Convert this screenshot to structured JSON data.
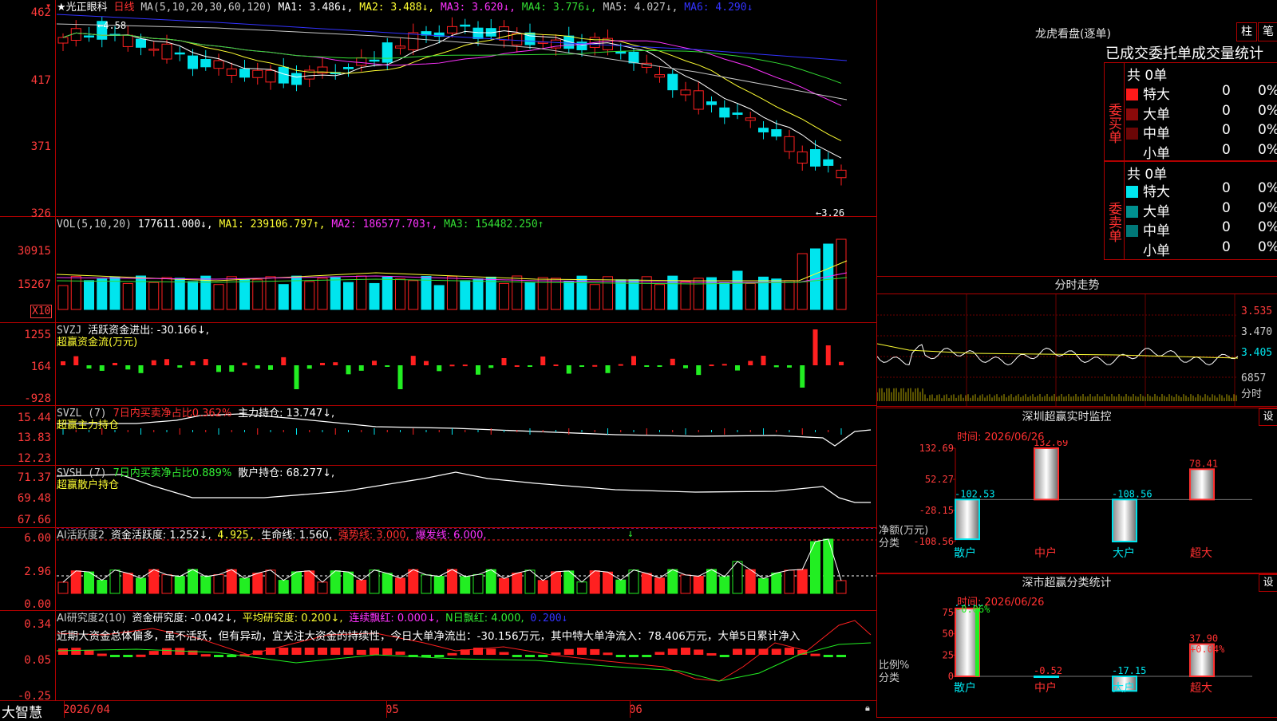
{
  "brand": "大智慧",
  "colors": {
    "up": "#ff2020",
    "down": "#00e5ee",
    "grid": "#b00000",
    "ma1": "#ffffff",
    "ma2": "#ffff33",
    "ma3": "#ff33ff",
    "ma4": "#33dd33",
    "ma5": "#c8c8c8",
    "ma6": "#3333ff",
    "green": "#22ee22"
  },
  "kline": {
    "star": "★",
    "stock": "光正眼科",
    "period": "日线",
    "ma_label": "MA(5,10,20,30,60,120)",
    "ma1": "MA1: 3.486↓,",
    "ma2": "MA2: 3.488↓,",
    "ma3": "MA3: 3.620↓,",
    "ma4": "MA4: 3.776↓,",
    "ma5": "MA5: 4.027↓,",
    "ma6": "MA6: 4.290↓",
    "yticks": [
      "462",
      "417",
      "371",
      "326"
    ],
    "high_note": "4.58",
    "low_note": "←3.26"
  },
  "vol": {
    "label": "VOL(5,10,20)",
    "v": "177611.000↓,",
    "ma1": "MA1: 239106.797↑,",
    "ma2": "MA2: 186577.703↑,",
    "ma3": "MA3: 154482.250↑",
    "yticks": [
      "30915",
      "15267"
    ],
    "unit": "X10"
  },
  "svzj": {
    "label": "SVZJ",
    "t1": "活跃资金进出: -30.166↓,",
    "t2": "超赢资金流(万元)",
    "yticks": [
      "1255",
      "164",
      "-928"
    ]
  },
  "svzl": {
    "label": "SVZL (7)",
    "t1": "7日内买卖净占比0.362%",
    "t2": "主力持仓: 13.747↓,",
    "t3": "超赢主力持仓",
    "yticks": [
      "15.44",
      "13.83",
      "12.23"
    ]
  },
  "svsh": {
    "label": "SVSH (7)",
    "t1": "7日内买卖净占比0.889%",
    "t2": "散户持仓: 68.277↓,",
    "t3": "超赢散户持仓",
    "yticks": [
      "71.37",
      "69.48",
      "67.66"
    ]
  },
  "ai1": {
    "label": "AI活跃度2",
    "t1": "资金活跃度: 1.252↓,",
    "t2": "4.925,",
    "t3": "生命线: 1.560,",
    "t4": "强势线: 3.000,",
    "t5": "爆发线: 6.000,",
    "yticks": [
      "6.00",
      "2.96",
      "0.00"
    ]
  },
  "ai2": {
    "label": "AI研究度2(10)",
    "t1": "资金研究度: -0.042↓,",
    "t2": "平均研究度: 0.200↓,",
    "t3": "连续飘红: 0.000↓,",
    "t4": "N日飘红: 4.000,",
    "t5": "0.200↓",
    "comment": "近期大资金总体偏多，虽不活跃，但有异动，宜关注大资金的持续性，今日大单净流出：-30.156万元，其中特大单净流入：78.406万元，大单5日累计净入",
    "yticks": [
      "0.34",
      "0.05",
      "-0.25"
    ]
  },
  "xaxis": [
    "2026/04",
    "05",
    "06"
  ],
  "dragon": {
    "title": "龙虎看盘(逐单)",
    "btn_bar": "柱",
    "btn_pen": "笔",
    "subtitle": "已成交委托单成交量统计",
    "buy": {
      "side": "委买单",
      "total": "共 0单",
      "rows": [
        {
          "name": "特大",
          "n": "0",
          "p": "0%"
        },
        {
          "name": "大单",
          "n": "0",
          "p": "0%"
        },
        {
          "name": "中单",
          "n": "0",
          "p": "0%"
        },
        {
          "name": "小单",
          "n": "0",
          "p": "0%"
        }
      ]
    },
    "sell": {
      "side": "委卖单",
      "total": "共 0单",
      "rows": [
        {
          "name": "特大",
          "n": "0",
          "p": "0%"
        },
        {
          "name": "大单",
          "n": "0",
          "p": "0%"
        },
        {
          "name": "中单",
          "n": "0",
          "p": "0%"
        },
        {
          "name": "小单",
          "n": "0",
          "p": "0%"
        }
      ]
    }
  },
  "intraday": {
    "title": "分时走势",
    "p1": "3.535",
    "p2": "3.470",
    "p3": "3.405",
    "vol": "6857",
    "vlabel": "分时"
  },
  "monitor": {
    "title": "深圳超赢实时监控",
    "btn": "设",
    "time": "时间: 2026/06/26",
    "yticks": [
      "132.69",
      "52.27",
      "-28.15",
      "-108.56"
    ],
    "ylabel": "净额(万元)",
    "xlabel": "分类",
    "cats": [
      "散户",
      "中户",
      "大户",
      "超大"
    ],
    "vals": [
      "-102.53",
      "132.69",
      "-108.56",
      "78.41"
    ],
    "values": [
      -102.53,
      132.69,
      -108.56,
      78.41
    ]
  },
  "classify": {
    "title": "深市超赢分类统计",
    "btn": "设",
    "time": "时间: 2026/06/26",
    "yticks": [
      "75",
      "50",
      "25",
      "0"
    ],
    "ylabel": "比例%",
    "xlabel": "分类",
    "cats": [
      "散户",
      "中户",
      "大户",
      "超大"
    ],
    "vals": [
      "79.78",
      "-0.52",
      "-17.15",
      "37.90"
    ],
    "top1": "-0.06%",
    "top4": "+0.04%",
    "values": [
      79.78,
      -0.52,
      -17.15,
      37.9
    ]
  }
}
